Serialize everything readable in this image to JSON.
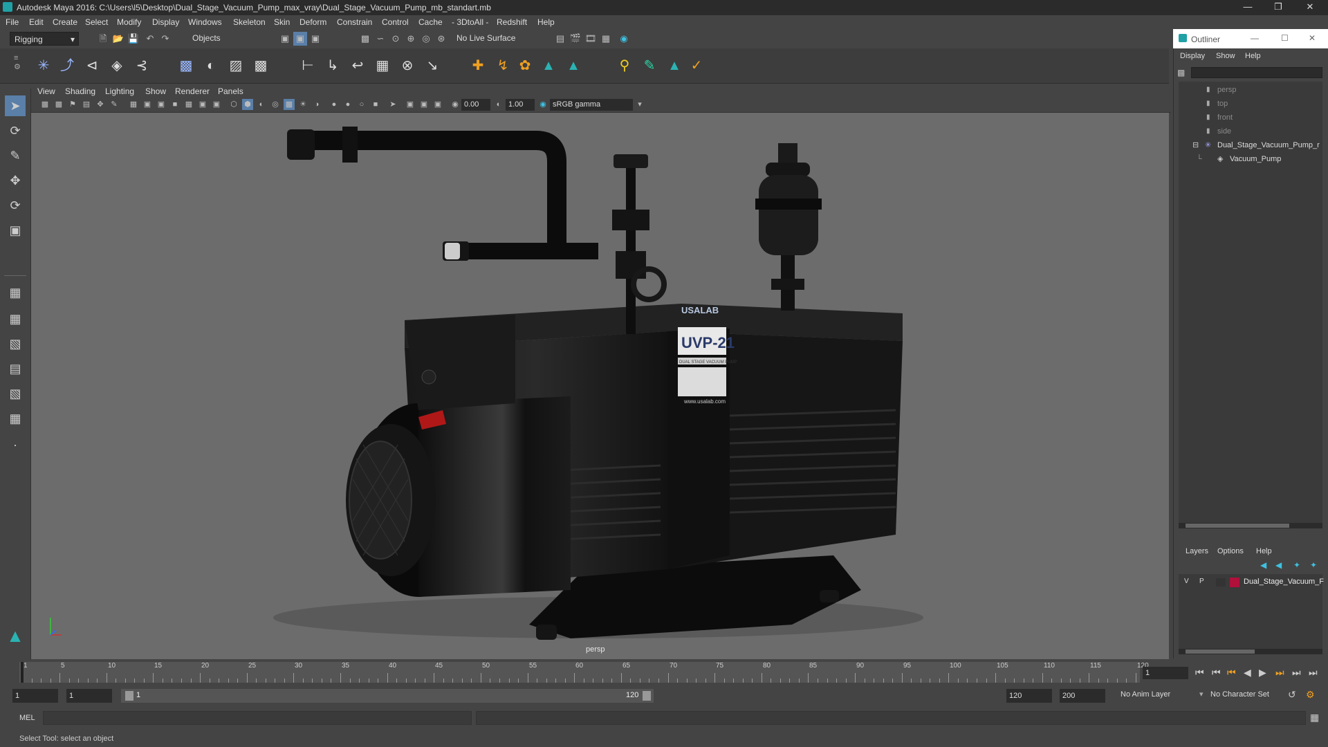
{
  "title_bar": {
    "title": "Autodesk Maya 2016: C:\\Users\\l5\\Desktop\\Dual_Stage_Vacuum_Pump_max_vray\\Dual_Stage_Vacuum_Pump_mb_standart.mb"
  },
  "menu": [
    "File",
    "Edit",
    "Create",
    "Select",
    "Modify",
    "Display",
    "Windows",
    "Skeleton",
    "Skin",
    "Deform",
    "Constrain",
    "Control",
    "Cache",
    "- 3DtoAll -",
    "Redshift",
    "Help"
  ],
  "status_line": {
    "mode": "Rigging",
    "objects_label": "Objects",
    "live_surface": "No Live Surface"
  },
  "viewport": {
    "menu": [
      "View",
      "Shading",
      "Lighting",
      "Show",
      "Renderer",
      "Panels"
    ],
    "exposure": "0.00",
    "gamma": "1.00",
    "color_space": "sRGB gamma",
    "camera": "persp"
  },
  "model_label": {
    "brand": "USALAB",
    "model": "UVP-21",
    "subtitle": "DUAL STAGE VACUUM PUMP",
    "url": "www.usalab.com"
  },
  "outliner": {
    "title": "Outliner",
    "menu": [
      "Display",
      "Show",
      "Help"
    ],
    "items": [
      {
        "label": "persp"
      },
      {
        "label": "top"
      },
      {
        "label": "front"
      },
      {
        "label": "side"
      },
      {
        "label": "Dual_Stage_Vacuum_Pump_r"
      },
      {
        "label": "Vacuum_Pump"
      }
    ]
  },
  "layers": {
    "menu": [
      "Layers",
      "Options",
      "Help"
    ],
    "row": {
      "v": "V",
      "p": "P",
      "name": "Dual_Stage_Vacuum_F",
      "color": "#b0103a"
    }
  },
  "timeline": {
    "ticks": [
      "1",
      "5",
      "10",
      "15",
      "20",
      "25",
      "30",
      "35",
      "40",
      "45",
      "50",
      "55",
      "60",
      "65",
      "70",
      "75",
      "80",
      "85",
      "90",
      "95",
      "100",
      "105",
      "110",
      "115",
      "120"
    ],
    "current_frame": "1"
  },
  "range": {
    "start": "1",
    "playback_start": "1",
    "slider_start": "1",
    "slider_end": "120",
    "playback_end": "120",
    "end": "200",
    "anim_layer": "No Anim Layer",
    "char_set": "No Character Set"
  },
  "command_line": {
    "label": "MEL"
  },
  "help_line": {
    "text": "Select Tool: select an object"
  }
}
